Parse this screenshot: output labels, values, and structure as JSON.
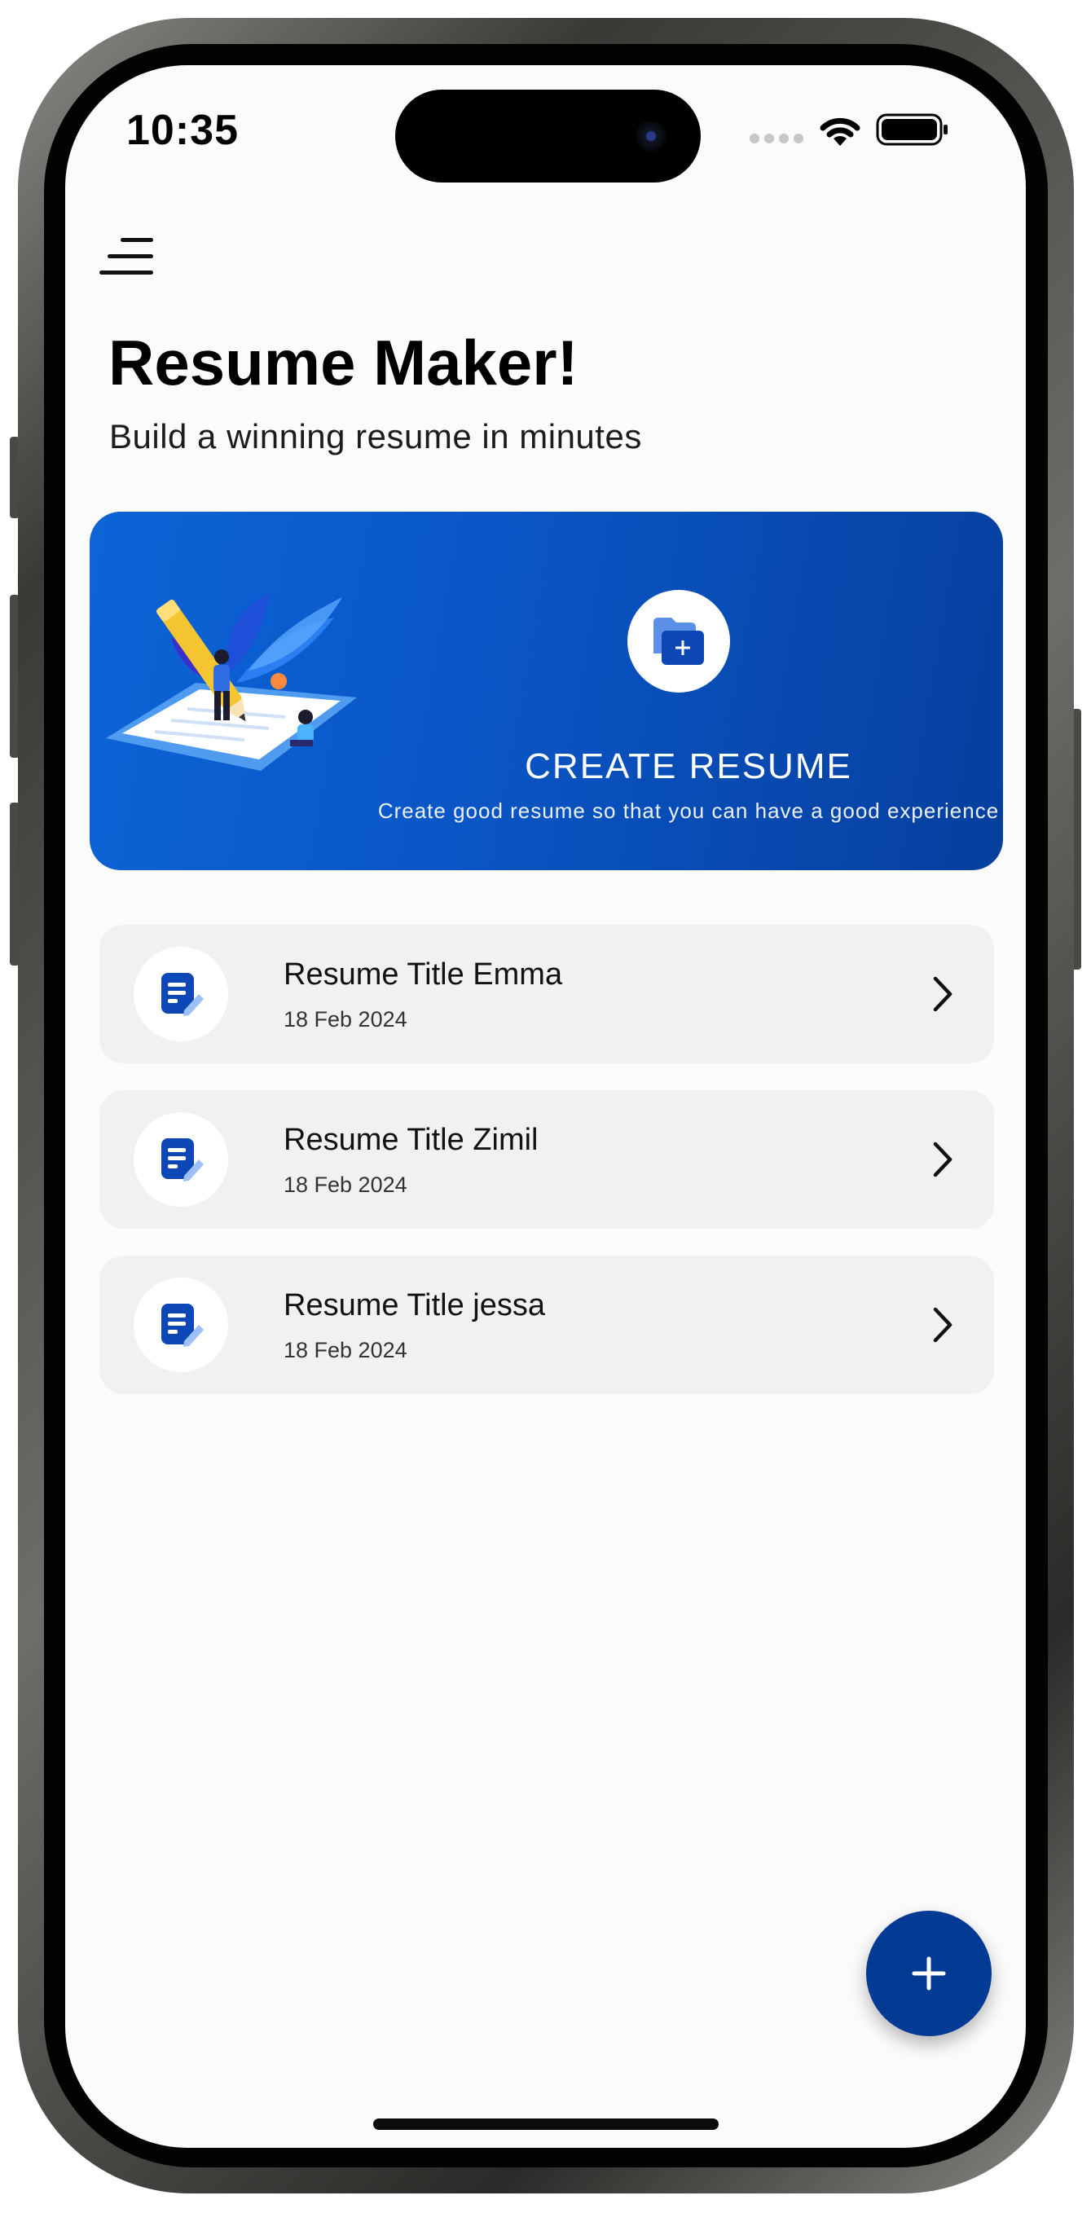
{
  "status_bar": {
    "time": "10:35"
  },
  "header": {
    "title": "Resume Maker!",
    "subtitle": "Build a winning resume in minutes"
  },
  "banner": {
    "title": "CREATE RESUME",
    "subtitle": "Create good resume so that you can have a good experience"
  },
  "resumes": [
    {
      "title": "Resume Title Emma",
      "date": "18 Feb 2024"
    },
    {
      "title": "Resume Title Zimil",
      "date": "18 Feb 2024"
    },
    {
      "title": "Resume Title jessa",
      "date": "18 Feb 2024"
    }
  ],
  "icons": {
    "menu": "menu-icon",
    "banner": "folder-add-icon",
    "resume": "document-edit-icon",
    "chevron": "chevron-right-icon",
    "fab": "plus-icon"
  },
  "colors": {
    "accent": "#033a94",
    "banner_start": "#0c64d6",
    "banner_end": "#063f9e",
    "card_bg": "#f1f1f1"
  }
}
